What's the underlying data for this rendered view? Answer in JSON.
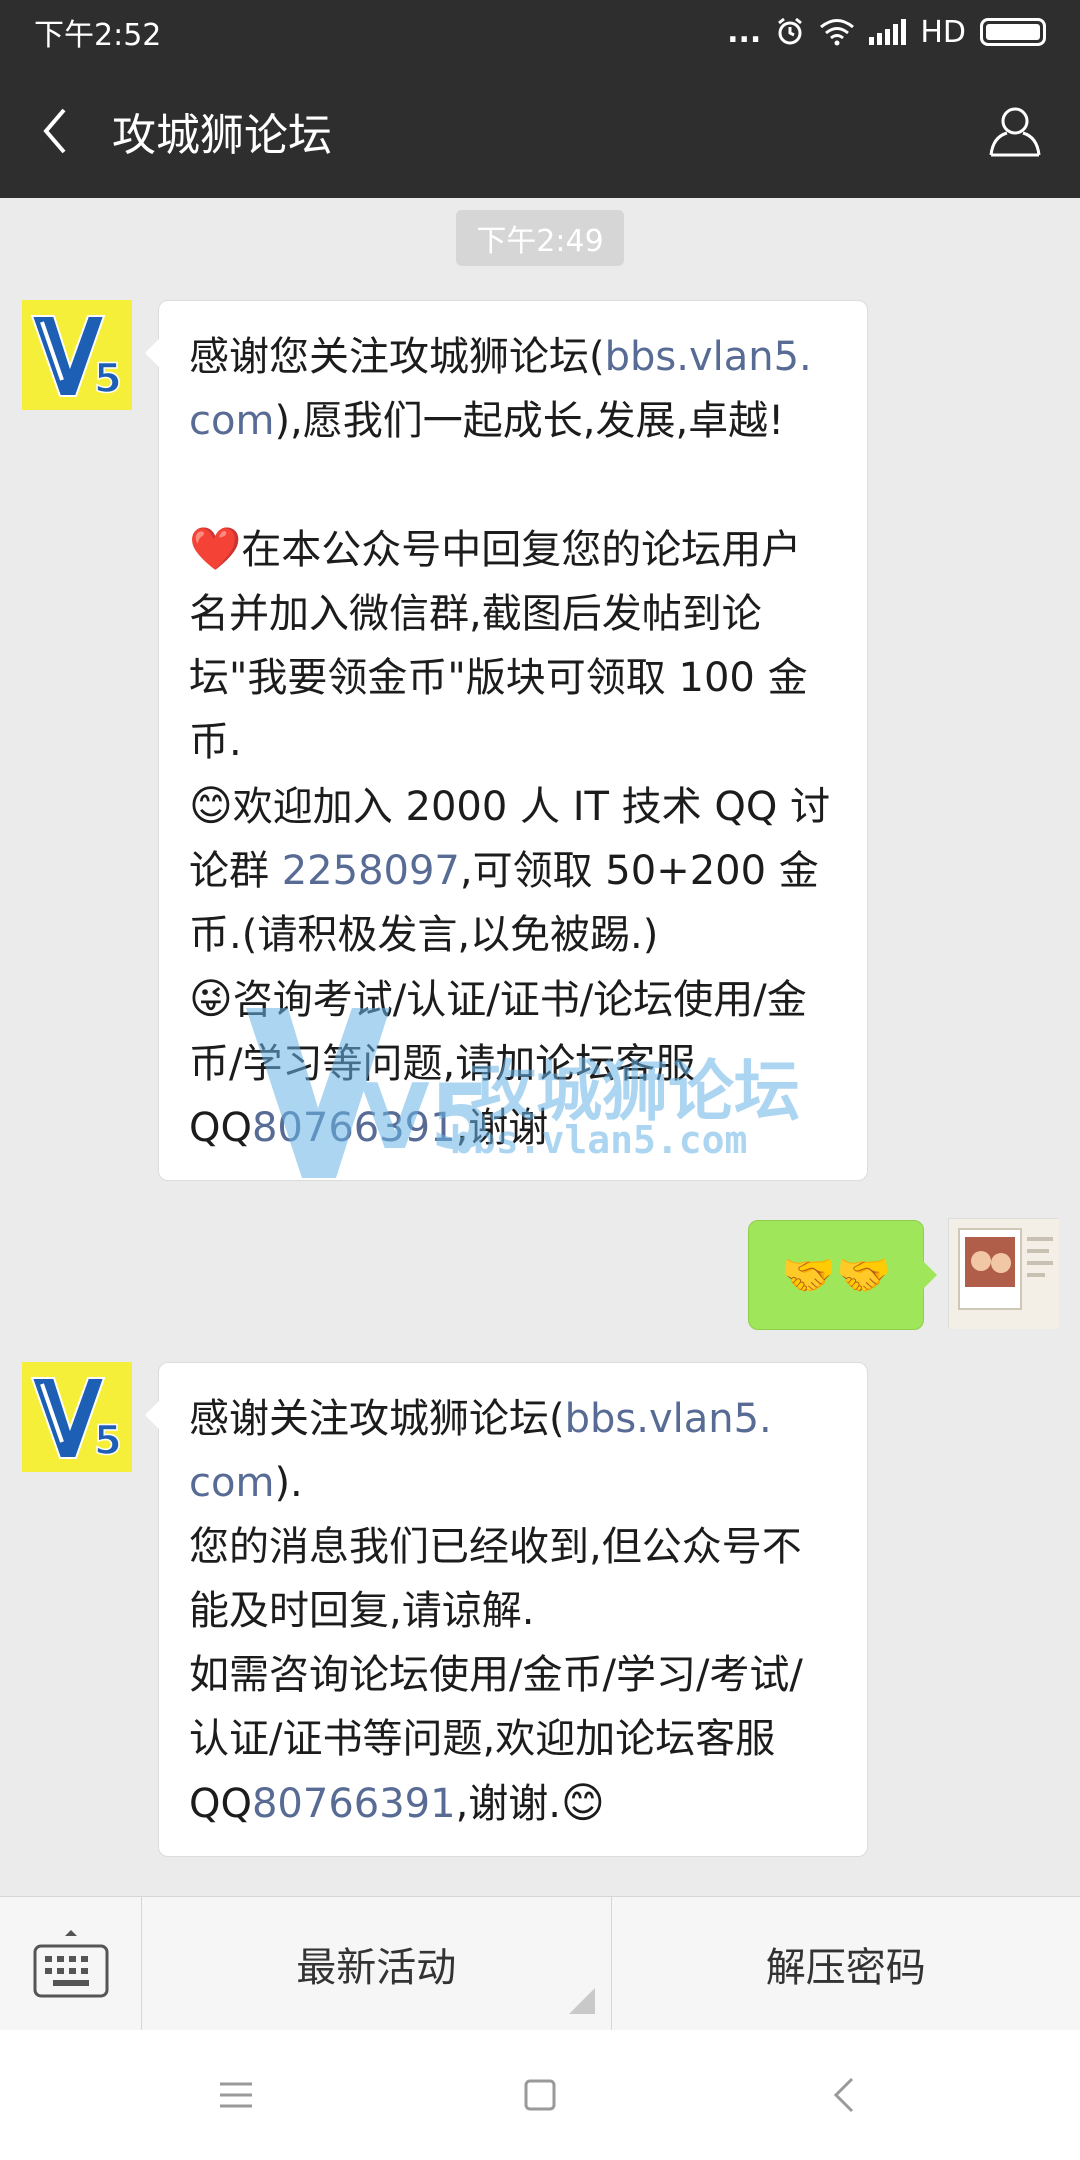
{
  "status_bar": {
    "time": "下午2:52",
    "dots": "...",
    "network": "HD"
  },
  "header": {
    "title": "攻城狮论坛"
  },
  "chat": {
    "timestamp": "下午2:49",
    "messages": [
      {
        "side": "left",
        "line1a": "感谢您关注攻城狮论坛(",
        "line1b": "bbs.vlan5.",
        "line2a": "com",
        "line2b": "),愿我们一起成长,发展,卓越!",
        "p2_emoji": "❤️",
        "p2_text": "在本公众号中回复您的论坛用户名并加入微信群,截图后发帖到论坛\"我要领金币\"版块可领取 100 金币.",
        "p3_emoji": "😊",
        "p3_text_a": "欢迎加入 2000 人 IT 技术 QQ 讨论群 ",
        "p3_link": "2258097",
        "p3_text_b": ",可领取 50+200 金币.(请积极发言,以免被踢.)",
        "p4_emoji": "😜",
        "p4_text_a": "咨询考试/认证/证书/论坛使用/金币/学习等问题,请加论坛客服 QQ",
        "p4_link": "80766391",
        "p4_text_b": ",谢谢"
      },
      {
        "side": "right",
        "text": "🤝🤝"
      },
      {
        "side": "left",
        "line1a": "感谢关注攻城狮论坛(",
        "line1b": "bbs.vlan5.",
        "line2a": "com",
        "line2b": ").",
        "p2_text": "您的消息我们已经收到,但公众号不能及时回复,请谅解.",
        "p3_text_a": "如需咨询论坛使用/金币/学习/考试/认证/证书等问题,欢迎加论坛客服 QQ",
        "p3_link": "80766391",
        "p3_text_b": ",谢谢.",
        "p3_emoji": "😊"
      }
    ],
    "watermark": {
      "logo_text": "V5",
      "title": "攻城狮论坛",
      "url": "bbs.vlan5.com"
    }
  },
  "bottom_menu": {
    "items": [
      "最新活动",
      "解压密码"
    ]
  },
  "colors": {
    "header_bg": "#2e2e2e",
    "chat_bg": "#ebebeb",
    "link": "#576b95",
    "sent_bubble": "#a0e65a",
    "avatar_yellow": "#f6ef3a",
    "avatar_blue": "#1c5fb4"
  }
}
